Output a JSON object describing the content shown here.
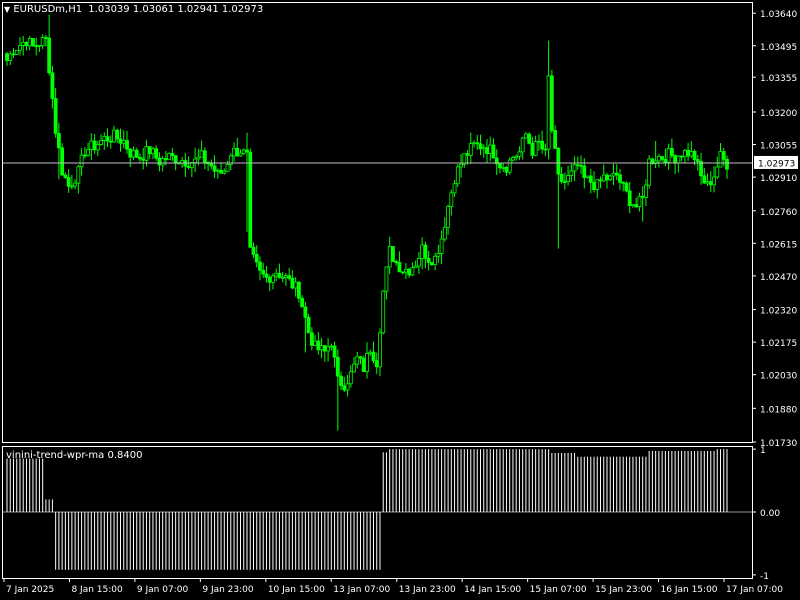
{
  "header": {
    "symbol": "EURUSDm,H1",
    "ohlc": "1.03039 1.03061 1.02941 1.02973"
  },
  "indicator": {
    "label": "vinini-trend-wpr-ma 0.8400"
  },
  "colors": {
    "background": "#000000",
    "frame": "#ffffff",
    "candle_up": "#00ff00",
    "candle_down": "#00ff00",
    "bid_line": "#c0c0c0",
    "indicator_bar": "#ffffff",
    "price_tag_bg": "#ffffff",
    "price_tag_text": "#000000"
  },
  "chart_data": [
    {
      "type": "candlestick",
      "title": "EURUSDm,H1",
      "ylim": [
        1.0173,
        1.0369
      ],
      "y_ticks": [
        "1.03640",
        "1.03495",
        "1.03355",
        "1.03200",
        "1.03055",
        "1.02910",
        "1.02760",
        "1.02615",
        "1.02470",
        "1.02320",
        "1.02175",
        "1.02030",
        "1.01880",
        "1.01730"
      ],
      "x_ticks": [
        "7 Jan 2025",
        "8 Jan 15:00",
        "9 Jan 07:00",
        "9 Jan 23:00",
        "10 Jan 15:00",
        "13 Jan 07:00",
        "13 Jan 23:00",
        "14 Jan 15:00",
        "15 Jan 07:00",
        "15 Jan 23:00",
        "16 Jan 15:00",
        "17 Jan 07:00"
      ],
      "current_price": "1.02973",
      "anchors": [
        [
          0,
          1.0343
        ],
        [
          2,
          1.0348
        ],
        [
          6,
          1.0352
        ],
        [
          8,
          1.0349
        ],
        [
          10,
          1.0351
        ],
        [
          12,
          1.0352
        ],
        [
          13,
          1.034
        ],
        [
          15,
          1.0312
        ],
        [
          17,
          1.0294
        ],
        [
          19,
          1.0287
        ],
        [
          22,
          1.0293
        ],
        [
          24,
          1.0303
        ],
        [
          27,
          1.0305
        ],
        [
          30,
          1.0308
        ],
        [
          33,
          1.0309
        ],
        [
          36,
          1.0307
        ],
        [
          38,
          1.0302
        ],
        [
          41,
          1.03
        ],
        [
          44,
          1.0303
        ],
        [
          47,
          1.0298
        ],
        [
          50,
          1.03
        ],
        [
          53,
          1.0299
        ],
        [
          56,
          1.0298
        ],
        [
          58,
          1.0298
        ],
        [
          60,
          1.03
        ],
        [
          63,
          1.0296
        ],
        [
          65,
          1.0292
        ],
        [
          67,
          1.0294
        ],
        [
          69,
          1.0302
        ],
        [
          72,
          1.0303
        ],
        [
          74,
          1.03
        ],
        [
          75,
          1.0257
        ],
        [
          78,
          1.0248
        ],
        [
          80,
          1.0246
        ],
        [
          83,
          1.0249
        ],
        [
          86,
          1.0246
        ],
        [
          90,
          1.024
        ],
        [
          93,
          1.0222
        ],
        [
          95,
          1.0215
        ],
        [
          98,
          1.0213
        ],
        [
          100,
          1.0218
        ],
        [
          102,
          1.02
        ],
        [
          104,
          1.0199
        ],
        [
          106,
          1.0203
        ],
        [
          108,
          1.021
        ],
        [
          110,
          1.0206
        ],
        [
          112,
          1.0215
        ],
        [
          114,
          1.0209
        ],
        [
          116,
          1.024
        ],
        [
          118,
          1.0258
        ],
        [
          120,
          1.0253
        ],
        [
          122,
          1.025
        ],
        [
          124,
          1.025
        ],
        [
          126,
          1.0253
        ],
        [
          128,
          1.0259
        ],
        [
          130,
          1.0255
        ],
        [
          132,
          1.0255
        ],
        [
          134,
          1.0264
        ],
        [
          136,
          1.0278
        ],
        [
          138,
          1.0291
        ],
        [
          141,
          1.03
        ],
        [
          144,
          1.0305
        ],
        [
          147,
          1.0305
        ],
        [
          150,
          1.0302
        ],
        [
          152,
          1.0297
        ],
        [
          154,
          1.0296
        ],
        [
          156,
          1.03
        ],
        [
          158,
          1.0302
        ],
        [
          160,
          1.031
        ],
        [
          162,
          1.0303
        ],
        [
          164,
          1.0306
        ],
        [
          166,
          1.0301
        ],
        [
          167,
          1.0335
        ],
        [
          168,
          1.0312
        ],
        [
          170,
          1.029
        ],
        [
          172,
          1.0289
        ],
        [
          174,
          1.0292
        ],
        [
          176,
          1.0296
        ],
        [
          178,
          1.029
        ],
        [
          180,
          1.0289
        ],
        [
          182,
          1.0287
        ],
        [
          184,
          1.0291
        ],
        [
          186,
          1.029
        ],
        [
          188,
          1.0292
        ],
        [
          190,
          1.0286
        ],
        [
          192,
          1.0281
        ],
        [
          194,
          1.0278
        ],
        [
          196,
          1.0281
        ],
        [
          198,
          1.0298
        ],
        [
          200,
          1.03
        ],
        [
          202,
          1.03
        ],
        [
          204,
          1.0301
        ],
        [
          206,
          1.03
        ],
        [
          208,
          1.0302
        ],
        [
          210,
          1.0302
        ],
        [
          212,
          1.03
        ],
        [
          214,
          1.0291
        ],
        [
          216,
          1.0287
        ],
        [
          218,
          1.0292
        ],
        [
          220,
          1.03
        ],
        [
          222,
          1.0297
        ]
      ]
    },
    {
      "type": "bar",
      "title": "vinini-trend-wpr-ma 0.8400",
      "ylim": [
        -1.05,
        1.05
      ],
      "y_ticks": [
        "1",
        "0.00",
        "-1"
      ],
      "segments": [
        [
          0,
          11,
          0.85
        ],
        [
          12,
          14,
          0.2
        ],
        [
          15,
          115,
          -0.92
        ],
        [
          116,
          117,
          0.95
        ],
        [
          118,
          167,
          1.0
        ],
        [
          168,
          175,
          0.94
        ],
        [
          176,
          197,
          0.88
        ],
        [
          198,
          218,
          0.97
        ],
        [
          219,
          222,
          1.0
        ]
      ]
    }
  ]
}
